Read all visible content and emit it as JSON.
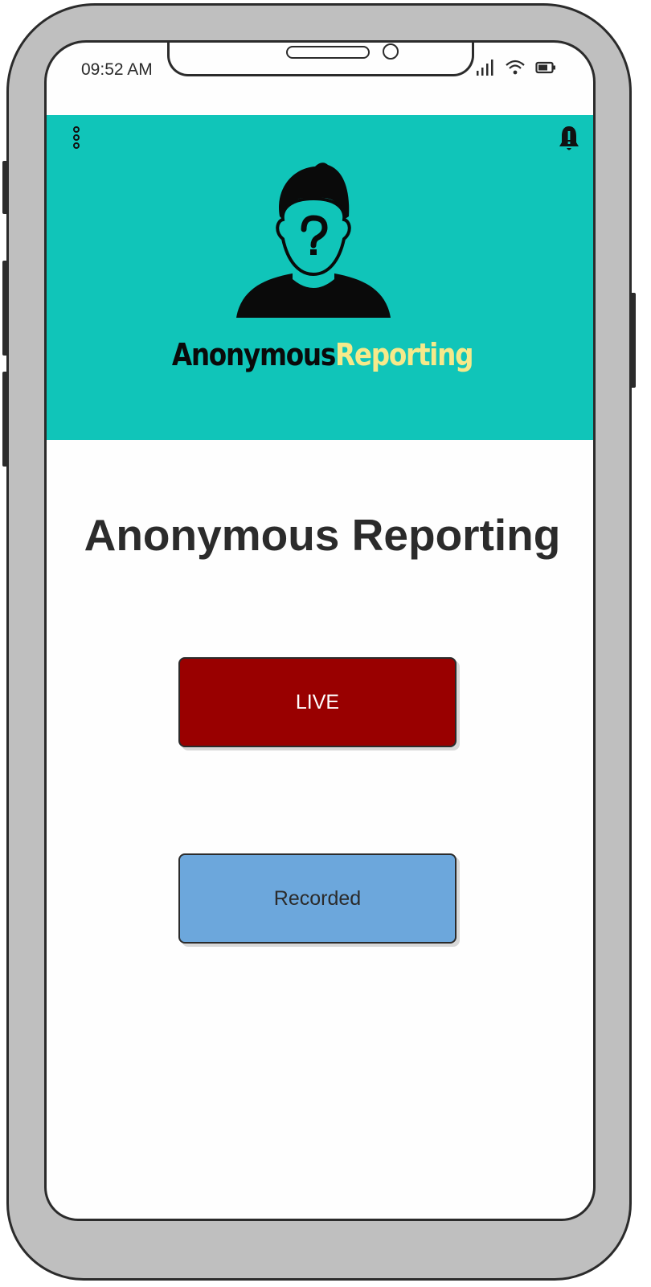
{
  "status_bar": {
    "time": "09:52 AM",
    "icons": [
      "signal-icon",
      "wifi-icon",
      "battery-icon"
    ]
  },
  "header": {
    "menu_icon": "more-vertical-icon",
    "bell_icon": "bell-alert-icon",
    "logo_text_part1": "Anonymous",
    "logo_text_part2": "Reporting",
    "banner_color": "#10c5b9"
  },
  "main": {
    "title": "Anonymous Reporting",
    "live_button_label": "LIVE",
    "recorded_button_label": "Recorded",
    "live_color": "#990000",
    "recorded_color": "#6ca7dc"
  }
}
